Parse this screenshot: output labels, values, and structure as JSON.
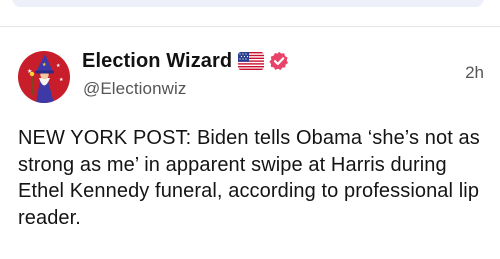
{
  "post": {
    "author_name": "Election Wizard",
    "handle": "@Electionwiz",
    "timestamp": "2h",
    "text": "NEW YORK POST: Biden tells Obama ‘she’s not as strong as me’ in apparent swipe at Harris during Ethel Kennedy funeral, according to professional lip reader.",
    "flag_icon": "us-flag-icon",
    "badge_icon": "verified-badge-icon",
    "colors": {
      "avatar_bg": "#c81e2c",
      "badge": "#e8446a",
      "top_card_bg": "#eef0f9"
    }
  }
}
